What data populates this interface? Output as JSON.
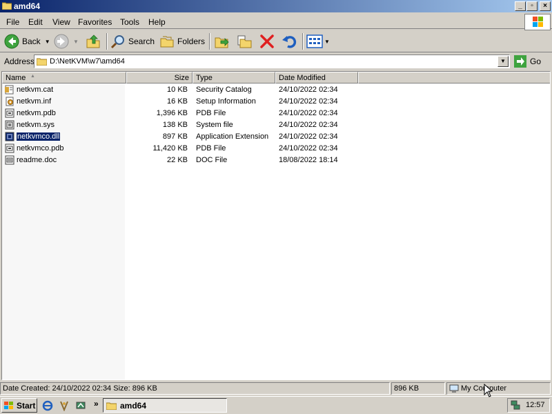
{
  "window": {
    "title": "amd64",
    "buttons": {
      "minimize": "_",
      "maximize": "▫",
      "close": "×"
    }
  },
  "menu": [
    "File",
    "Edit",
    "View",
    "Favorites",
    "Tools",
    "Help"
  ],
  "toolbar": {
    "back": "Back",
    "search": "Search",
    "folders": "Folders"
  },
  "address": {
    "label": "Address",
    "value": "D:\\NetKVM\\w7\\amd64",
    "go": "Go"
  },
  "columns": {
    "name": "Name",
    "size": "Size",
    "type": "Type",
    "date": "Date Modified"
  },
  "files": [
    {
      "name": "netkvm.cat",
      "size": "10 KB",
      "type": "Security Catalog",
      "date": "24/10/2022 02:34",
      "icon": "catalog-file-icon"
    },
    {
      "name": "netkvm.inf",
      "size": "16 KB",
      "type": "Setup Information",
      "date": "24/10/2022 02:34",
      "icon": "inf-file-icon"
    },
    {
      "name": "netkvm.pdb",
      "size": "1,396 KB",
      "type": "PDB File",
      "date": "24/10/2022 02:34",
      "icon": "pdb-file-icon"
    },
    {
      "name": "netkvm.sys",
      "size": "138 KB",
      "type": "System file",
      "date": "24/10/2022 02:34",
      "icon": "sys-file-icon"
    },
    {
      "name": "netkvmco.dll",
      "size": "897 KB",
      "type": "Application Extension",
      "date": "24/10/2022 02:34",
      "icon": "dll-file-icon",
      "selected": true
    },
    {
      "name": "netkvmco.pdb",
      "size": "11,420 KB",
      "type": "PDB File",
      "date": "24/10/2022 02:34",
      "icon": "pdb-file-icon"
    },
    {
      "name": "readme.doc",
      "size": "22 KB",
      "type": "DOC File",
      "date": "18/08/2022 18:14",
      "icon": "doc-file-icon"
    }
  ],
  "status": {
    "details": "Date Created: 24/10/2022 02:34 Size: 896 KB",
    "size": "896 KB",
    "location": "My Computer"
  },
  "taskbar": {
    "start": "Start",
    "task": "amd64",
    "overflow": "»",
    "clock": "12:57"
  },
  "colors": {
    "title_start": "#0a246a",
    "title_end": "#a6caf0",
    "selection": "#0a246a",
    "face": "#d4d0c8"
  }
}
